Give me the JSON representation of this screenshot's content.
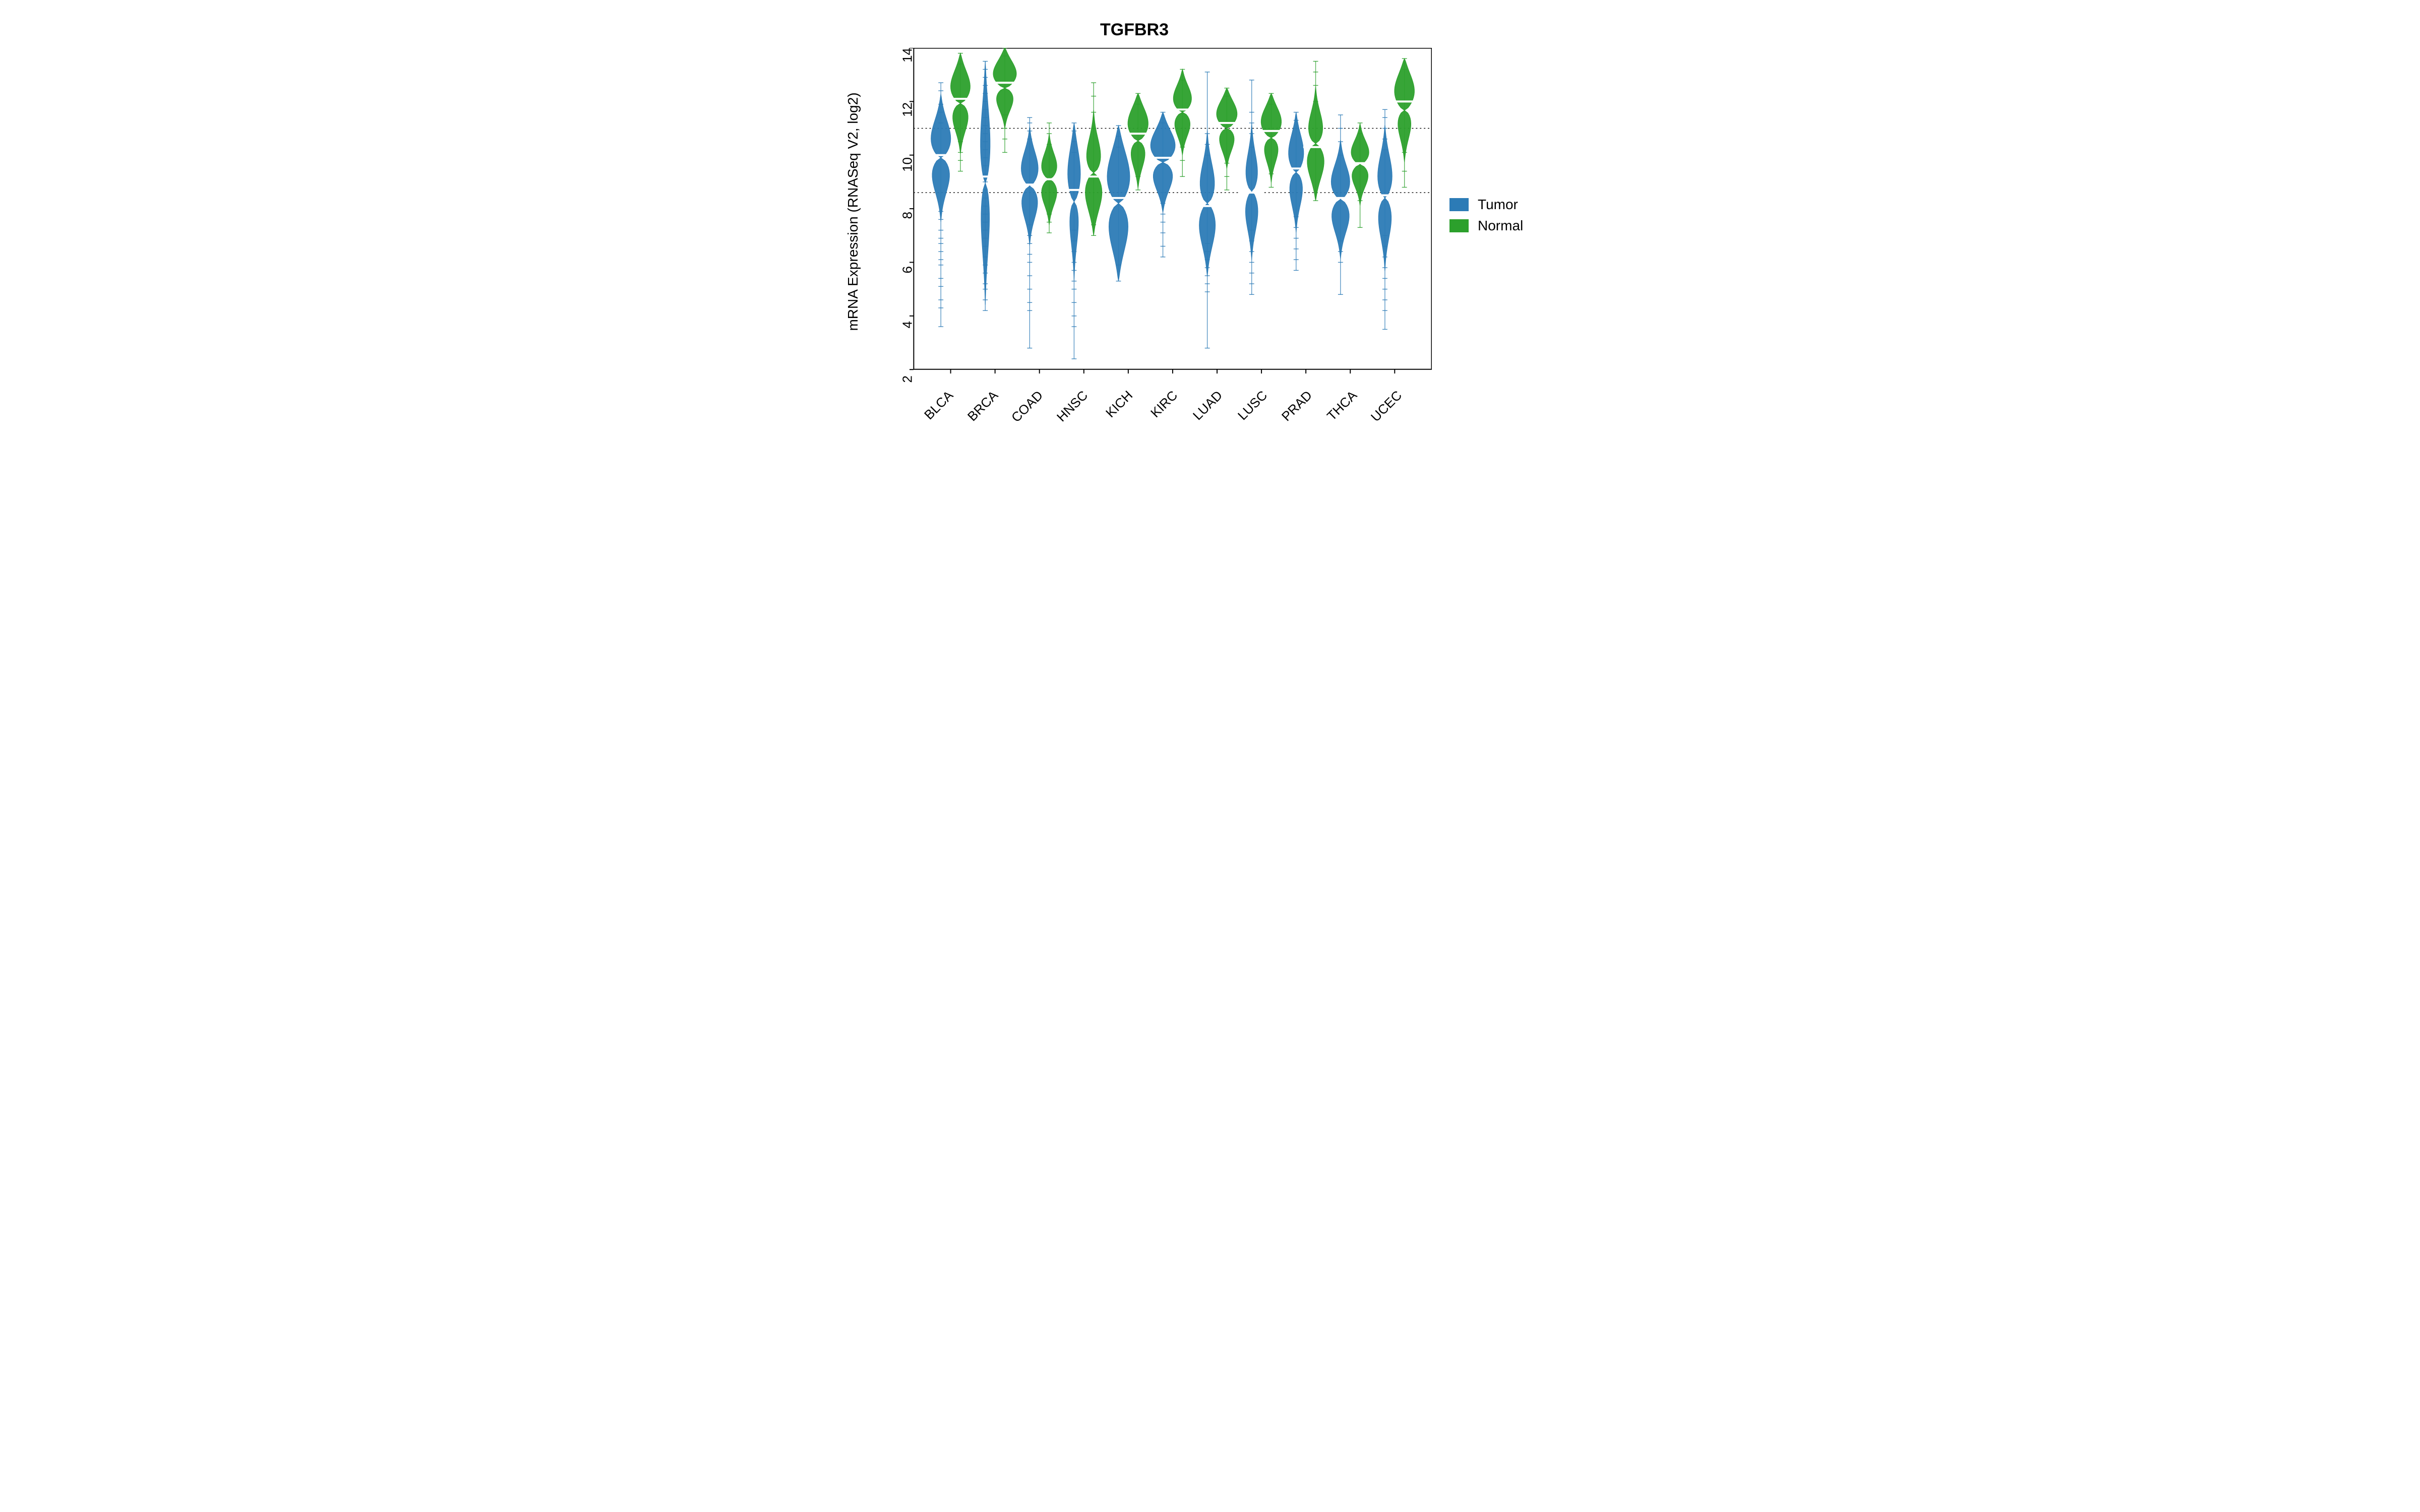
{
  "chart_data": {
    "type": "violin",
    "title": "TGFBR3",
    "xlabel": "",
    "ylabel": "mRNA Expression (RNASeq V2, log2)",
    "ylim": [
      2,
      14
    ],
    "y_ticks": [
      2,
      4,
      6,
      8,
      10,
      12,
      14
    ],
    "categories": [
      "BLCA",
      "BRCA",
      "COAD",
      "HNSC",
      "KICH",
      "KIRC",
      "LUAD",
      "LUSC",
      "PRAD",
      "THCA",
      "UCEC"
    ],
    "series": [
      {
        "name": "Tumor",
        "color": "#2c7bb6"
      },
      {
        "name": "Normal",
        "color": "#2ca02c"
      }
    ],
    "reference_lines": [
      8.6,
      11.0
    ],
    "legend": {
      "position": "right"
    },
    "violins": {
      "BLCA": {
        "Tumor": {
          "median": 10.0,
          "q1": 9.2,
          "q3": 10.6,
          "min": 3.6,
          "max": 12.7,
          "mode_width": 0.68,
          "sparse_points": [
            3.6,
            4.3,
            4.6,
            5.1,
            5.4,
            5.9,
            6.1,
            6.4,
            6.7,
            6.9,
            7.2,
            7.6,
            7.9,
            11.2,
            11.6,
            11.9,
            12.4,
            12.7
          ]
        },
        "Normal": {
          "median": 12.1,
          "q1": 11.5,
          "q3": 12.7,
          "min": 9.4,
          "max": 13.8,
          "mode_width": 0.62,
          "sparse_points": [
            9.4,
            9.8,
            10.1,
            10.5,
            13.4,
            13.8
          ]
        }
      },
      "BRCA": {
        "Tumor": {
          "median": 9.2,
          "q1": 7.9,
          "q3": 10.8,
          "min": 4.2,
          "max": 13.5,
          "mode_width": 0.32,
          "sparse_points": [
            4.2,
            4.6,
            5.0,
            5.2,
            5.6,
            5.9,
            6.2,
            6.6,
            6.9,
            7.2,
            7.5,
            7.8,
            8.1,
            8.4,
            8.7,
            9.0,
            9.3,
            9.6,
            9.9,
            10.2,
            10.5,
            10.8,
            11.1,
            11.4,
            11.7,
            12.0,
            12.3,
            12.6,
            12.9,
            13.2,
            13.5
          ]
        },
        "Normal": {
          "median": 12.7,
          "q1": 12.2,
          "q3": 13.2,
          "min": 10.1,
          "max": 14.0,
          "mode_width": 0.7,
          "sparse_points": [
            10.1,
            10.6,
            11.0,
            11.5,
            13.7,
            14.0
          ]
        }
      },
      "COAD": {
        "Tumor": {
          "median": 8.9,
          "q1": 8.2,
          "q3": 9.5,
          "min": 2.8,
          "max": 11.4,
          "mode_width": 0.6,
          "sparse_points": [
            2.8,
            4.2,
            4.5,
            5.0,
            5.5,
            6.0,
            6.3,
            6.7,
            7.0,
            7.4,
            10.6,
            10.9,
            11.2,
            11.4
          ]
        },
        "Normal": {
          "median": 9.1,
          "q1": 8.6,
          "q3": 9.6,
          "min": 7.1,
          "max": 11.2,
          "mode_width": 0.56,
          "sparse_points": [
            7.1,
            7.5,
            7.8,
            10.4,
            10.8,
            11.2
          ]
        }
      },
      "HNSC": {
        "Tumor": {
          "median": 8.7,
          "q1": 7.6,
          "q3": 9.5,
          "min": 2.4,
          "max": 11.2,
          "mode_width": 0.38,
          "sparse_points": [
            2.4,
            3.6,
            4.0,
            4.5,
            5.0,
            5.3,
            5.7,
            6.0,
            6.4,
            6.8,
            7.2,
            10.1,
            10.5,
            10.9,
            11.2
          ]
        },
        "Normal": {
          "median": 9.2,
          "q1": 8.6,
          "q3": 10.0,
          "min": 7.0,
          "max": 12.7,
          "mode_width": 0.56,
          "sparse_points": [
            7.0,
            7.4,
            11.0,
            11.6,
            12.2,
            12.7
          ]
        }
      },
      "KICH": {
        "Tumor": {
          "median": 8.4,
          "q1": 7.4,
          "q3": 9.4,
          "min": 5.3,
          "max": 11.1,
          "mode_width": 0.72,
          "sparse_points": [
            5.3,
            5.9,
            10.3,
            10.7,
            11.1
          ]
        },
        "Normal": {
          "median": 10.8,
          "q1": 10.2,
          "q3": 11.4,
          "min": 8.7,
          "max": 12.3,
          "mode_width": 0.6,
          "sparse_points": [
            8.7,
            9.2,
            11.9,
            12.3
          ]
        }
      },
      "KIRC": {
        "Tumor": {
          "median": 9.9,
          "q1": 9.3,
          "q3": 10.5,
          "min": 6.2,
          "max": 11.6,
          "mode_width": 0.78,
          "sparse_points": [
            6.2,
            6.6,
            7.1,
            7.5,
            7.8,
            8.2,
            8.6,
            11.2,
            11.6
          ]
        },
        "Normal": {
          "median": 11.7,
          "q1": 11.2,
          "q3": 12.2,
          "min": 9.2,
          "max": 13.2,
          "mode_width": 0.6,
          "sparse_points": [
            9.2,
            9.8,
            10.3,
            12.8,
            13.2
          ]
        }
      },
      "LUAD": {
        "Tumor": {
          "median": 8.1,
          "q1": 7.4,
          "q3": 9.0,
          "min": 2.8,
          "max": 13.1,
          "mode_width": 0.56,
          "sparse_points": [
            2.8,
            4.9,
            5.2,
            5.5,
            5.8,
            6.1,
            6.4,
            6.7,
            10.0,
            10.4,
            10.8,
            13.1
          ]
        },
        "Normal": {
          "median": 11.2,
          "q1": 10.7,
          "q3": 11.7,
          "min": 8.7,
          "max": 12.5,
          "mode_width": 0.62,
          "sparse_points": [
            8.7,
            9.2,
            9.7,
            12.2,
            12.5
          ]
        }
      },
      "LUSC": {
        "Tumor": {
          "median": 8.6,
          "q1": 7.9,
          "q3": 9.4,
          "min": 4.8,
          "max": 12.8,
          "mode_width": 0.44,
          "sparse_points": [
            4.8,
            5.2,
            5.6,
            6.0,
            6.4,
            6.8,
            7.2,
            10.3,
            10.8,
            11.2,
            11.6,
            12.8
          ]
        },
        "Normal": {
          "median": 10.9,
          "q1": 10.3,
          "q3": 11.4,
          "min": 8.8,
          "max": 12.3,
          "mode_width": 0.6,
          "sparse_points": [
            8.8,
            9.3,
            11.9,
            12.3
          ]
        }
      },
      "PRAD": {
        "Tumor": {
          "median": 9.5,
          "q1": 8.8,
          "q3": 10.2,
          "min": 5.7,
          "max": 11.6,
          "mode_width": 0.5,
          "sparse_points": [
            5.7,
            6.1,
            6.5,
            6.9,
            7.3,
            7.7,
            11.0,
            11.3,
            11.6
          ]
        },
        "Normal": {
          "median": 10.3,
          "q1": 9.7,
          "q3": 11.0,
          "min": 8.3,
          "max": 13.5,
          "mode_width": 0.56,
          "sparse_points": [
            8.3,
            12.0,
            12.6,
            13.1,
            13.5
          ]
        }
      },
      "THCA": {
        "Tumor": {
          "median": 8.4,
          "q1": 7.7,
          "q3": 9.0,
          "min": 4.8,
          "max": 11.5,
          "mode_width": 0.66,
          "sparse_points": [
            4.8,
            6.0,
            6.4,
            6.8,
            10.0,
            10.5,
            11.0,
            11.5
          ]
        },
        "Normal": {
          "median": 9.7,
          "q1": 9.2,
          "q3": 10.1,
          "min": 7.3,
          "max": 11.2,
          "mode_width": 0.62,
          "sparse_points": [
            7.3,
            8.3,
            10.8,
            11.2
          ]
        }
      },
      "UCEC": {
        "Tumor": {
          "median": 8.5,
          "q1": 7.6,
          "q3": 9.2,
          "min": 3.5,
          "max": 11.7,
          "mode_width": 0.5,
          "sparse_points": [
            3.5,
            4.2,
            4.6,
            5.0,
            5.4,
            5.8,
            6.2,
            6.6,
            7.0,
            10.2,
            10.6,
            11.0,
            11.4,
            11.7
          ]
        },
        "Normal": {
          "median": 12.0,
          "q1": 11.3,
          "q3": 12.6,
          "min": 8.8,
          "max": 13.6,
          "mode_width": 0.58,
          "sparse_points": [
            8.8,
            9.4,
            10.1,
            13.2,
            13.6
          ]
        }
      }
    }
  },
  "legend_rows": [
    {
      "key": "Tumor",
      "label": "Tumor"
    },
    {
      "key": "Normal",
      "label": "Normal"
    }
  ]
}
